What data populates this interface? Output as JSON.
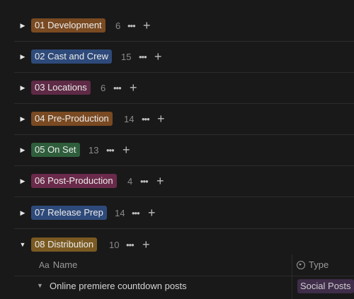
{
  "groups": [
    {
      "label": "01 Development",
      "count": "6",
      "color": "#7a4a22"
    },
    {
      "label": "02 Cast and Crew",
      "count": "15",
      "color": "#2e4a7a"
    },
    {
      "label": "03 Locations",
      "count": "6",
      "color": "#5e2a45"
    },
    {
      "label": "04 Pre-Production",
      "count": "14",
      "color": "#7a4a22"
    },
    {
      "label": "05 On Set",
      "count": "13",
      "color": "#2f5e3c"
    },
    {
      "label": "06 Post-Production",
      "count": "4",
      "color": "#6a2a4a"
    },
    {
      "label": "07 Release Prep",
      "count": "14",
      "color": "#2e4a7a"
    },
    {
      "label": "08 Distribution",
      "count": "10",
      "color": "#7a5a22"
    }
  ],
  "icons": {
    "collapsed": "▶",
    "expanded": "▼",
    "more": "•••",
    "add": "+"
  },
  "table": {
    "name_header": "Name",
    "name_icon": "Aa",
    "type_header": "Type",
    "rows": [
      {
        "title": "Online premiere countdown posts",
        "type": "Social Posts"
      }
    ]
  }
}
